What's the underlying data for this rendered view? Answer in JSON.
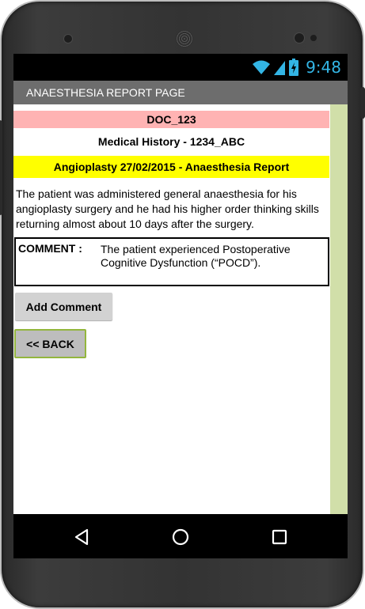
{
  "status_bar": {
    "time": "9:48"
  },
  "app": {
    "title": "ANAESTHESIA REPORT PAGE"
  },
  "report": {
    "doc_id": "DOC_123",
    "medical_history": "Medical History - 1234_ABC",
    "report_title": "Angioplasty 27/02/2015 - Anaesthesia Report",
    "body": "The patient was administered general anaesthesia for his angioplasty surgery and he had his higher order thinking skills returning almost about 10 days after the surgery.",
    "comment_label": "COMMENT :",
    "comment_text": "The patient experienced Postoperative Cognitive Dysfunction (“POCD”)."
  },
  "buttons": {
    "add_comment": "Add Comment",
    "back": "<< BACK"
  },
  "colors": {
    "doc_id_bg": "#ffb3b3",
    "report_title_bg": "#ffff00",
    "title_bar_bg": "#6d6d6d",
    "side_strip_bg": "#d1dfa9",
    "back_button_border": "#93b63d",
    "clock": "#33b5e5"
  },
  "icons": {
    "status": [
      "wifi-icon",
      "signal-icon",
      "battery-charging-icon"
    ],
    "nav": [
      "back-triangle-icon",
      "home-circle-icon",
      "recents-square-icon"
    ]
  }
}
